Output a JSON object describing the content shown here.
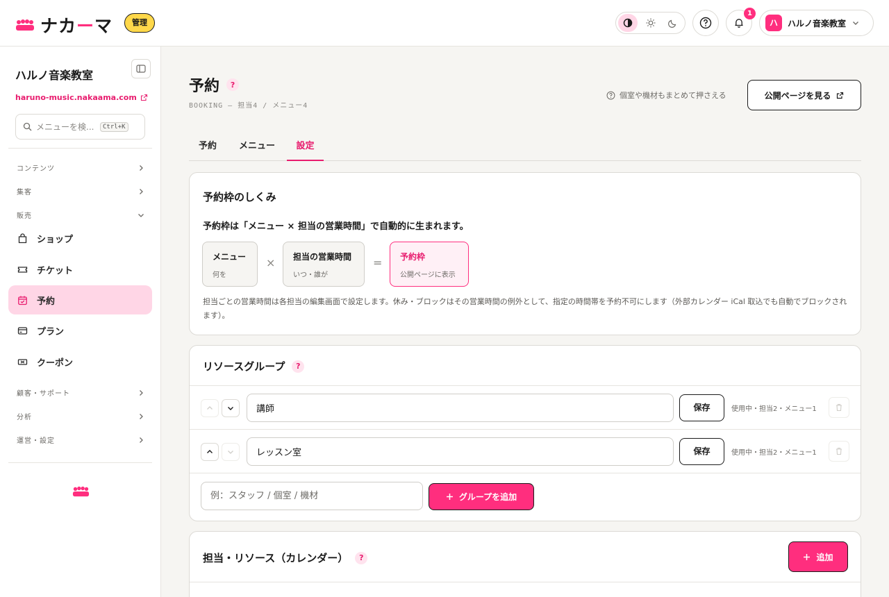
{
  "header": {
    "logo_text_a": "ナカ",
    "logo_text_dash": "ー",
    "logo_text_b": "マ",
    "admin_badge": "管理",
    "notification_count": "1",
    "account": {
      "avatar_letter": "ハ",
      "name": "ハルノ音楽教室"
    }
  },
  "sidebar": {
    "org_name": "ハルノ音楽教室",
    "site_url": "haruno-music.nakaama.com",
    "search_placeholder": "メニューを検...",
    "search_shortcut": "Ctrl+K",
    "sections": {
      "contents": "コンテンツ",
      "marketing": "集客",
      "sales": "販売",
      "customers": "顧客・サポート",
      "analytics": "分析",
      "operations": "運営・設定"
    },
    "items": [
      {
        "label": "ショップ",
        "icon": "bag-icon"
      },
      {
        "label": "チケット",
        "icon": "ticket-icon"
      },
      {
        "label": "予約",
        "icon": "calendar-icon",
        "active": true
      },
      {
        "label": "プラン",
        "icon": "card-icon"
      },
      {
        "label": "クーポン",
        "icon": "coupon-icon"
      }
    ]
  },
  "page": {
    "title": "予約",
    "help_mark": "?",
    "breadcrumb": "BOOKING — 担当4 / メニュー4",
    "hint": "個室や機材もまとめて押さえる",
    "public_button": "公開ページを見る"
  },
  "tabs": [
    {
      "label": "予約"
    },
    {
      "label": "メニュー"
    },
    {
      "label": "設定",
      "active": true
    }
  ],
  "mechanism": {
    "title": "予約枠のしくみ",
    "headline": "予約枠は「メニュー × 担当の営業時間」で自動的に生まれます。",
    "boxes": [
      {
        "title": "メニュー",
        "sub": "何を"
      },
      {
        "title": "担当の営業時間",
        "sub": "いつ・誰が"
      },
      {
        "title": "予約枠",
        "sub": "公開ページに表示"
      }
    ],
    "op_times": "×",
    "op_equals": "=",
    "note": "担当ごとの営業時間は各担当の編集画面で設定します。休み・ブロックはその営業時間の例外として、指定の時間帯を予約不可にします（外部カレンダー iCal 取込でも自動でブロックされます）。"
  },
  "resource_groups": {
    "title": "リソースグループ",
    "help_mark": "?",
    "rows": [
      {
        "name": "講師",
        "save": "保存",
        "usage": "使用中・担当2・メニュー1"
      },
      {
        "name": "レッスン室",
        "save": "保存",
        "usage": "使用中・担当2・メニュー1"
      }
    ],
    "new_placeholder": "例：スタッフ / 個室 / 機材",
    "add_button": "グループを追加"
  },
  "staff_resources": {
    "title": "担当・リソース（カレンダー）",
    "help_mark": "?",
    "add_button": "追加"
  },
  "colors": {
    "accent": "#ff2e7e",
    "accent_soft": "#ffd6e6",
    "badge_yellow": "#ffd84a"
  }
}
